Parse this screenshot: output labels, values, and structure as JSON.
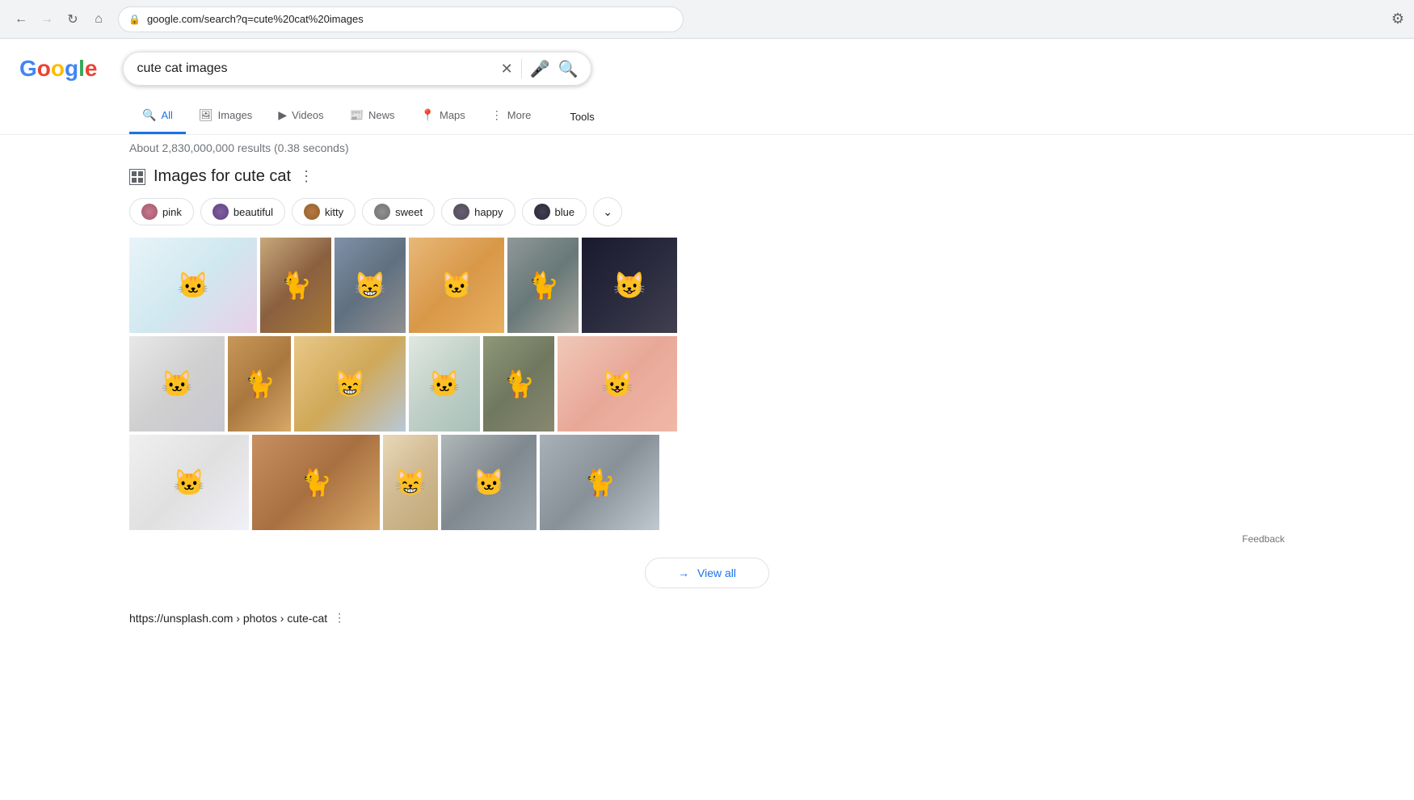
{
  "browser": {
    "url": "google.com/search?q=cute%20cat%20images",
    "back_disabled": false,
    "forward_disabled": true
  },
  "search": {
    "query": "cute cat images",
    "placeholder": "cute cat images",
    "results_info": "About 2,830,000,000 results (0.38 seconds)"
  },
  "nav_tabs": [
    {
      "id": "all",
      "label": "All",
      "icon": "🔍",
      "active": true
    },
    {
      "id": "images",
      "label": "Images",
      "icon": "🖼",
      "active": false
    },
    {
      "id": "videos",
      "label": "Videos",
      "icon": "▶",
      "active": false
    },
    {
      "id": "news",
      "label": "News",
      "icon": "📰",
      "active": false
    },
    {
      "id": "maps",
      "label": "Maps",
      "icon": "📍",
      "active": false
    },
    {
      "id": "more",
      "label": "More",
      "icon": "⋮",
      "active": false
    }
  ],
  "tools_label": "Tools",
  "images_section": {
    "title": "Images for cute cat",
    "more_icon": "⋮"
  },
  "filter_chips": [
    {
      "id": "pink",
      "label": "pink",
      "color": "chip-pink"
    },
    {
      "id": "beautiful",
      "label": "beautiful",
      "color": "chip-brown"
    },
    {
      "id": "kitty",
      "label": "kitty",
      "color": "chip-orange"
    },
    {
      "id": "sweet",
      "label": "sweet",
      "color": "chip-gray"
    },
    {
      "id": "happy",
      "label": "happy",
      "color": "chip-happy"
    },
    {
      "id": "blue",
      "label": "blue",
      "color": "chip-blue"
    }
  ],
  "view_all_label": "View all",
  "feedback_label": "Feedback",
  "bottom_result": {
    "url_display": "https://unsplash.com › photos › cute-cat",
    "more_icon": "⋮"
  }
}
